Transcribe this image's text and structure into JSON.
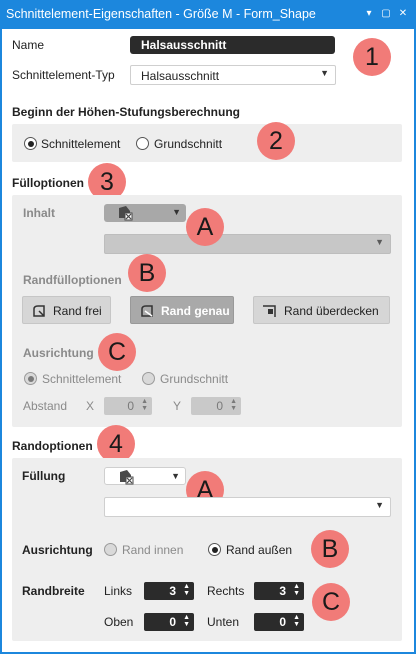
{
  "window": {
    "title": "Schnittelement-Eigenschaften - Größe M - Form_Shape",
    "buttons": {
      "dropdown_icon": "▾",
      "maximize_icon": "▢",
      "close_icon": "✕"
    }
  },
  "header": {
    "name_label": "Name",
    "name_value": "Halsausschnitt",
    "type_label": "Schnittelement-Typ",
    "type_value": "Halsausschnitt"
  },
  "beginn": {
    "title": "Beginn der Höhen-Stufungsberechnung",
    "options": [
      "Schnittelement",
      "Grundschnitt"
    ],
    "selected": "Schnittelement"
  },
  "fuelloptionen": {
    "title": "Fülloptionen",
    "inhalt_label": "Inhalt",
    "inhalt_select_value": "",
    "randfuell_title": "Randfülloptionen",
    "buttons": [
      "Rand frei",
      "Rand genau",
      "Rand überdecken"
    ],
    "selected_button": "Rand genau",
    "ausrichtung_label": "Ausrichtung",
    "ausrichtung_options": [
      "Schnittelement",
      "Grundschnitt"
    ],
    "ausrichtung_selected": "Schnittelement",
    "abstand_label": "Abstand",
    "x_label": "X",
    "x_value": "0",
    "y_label": "Y",
    "y_value": "0"
  },
  "randoptionen": {
    "title": "Randoptionen",
    "fuellung_label": "Füllung",
    "fuellung_select_value": "",
    "ausrichtung_label": "Ausrichtung",
    "ausrichtung_options": [
      "Rand innen",
      "Rand außen"
    ],
    "ausrichtung_selected": "Rand außen",
    "randbreite_label": "Randbreite",
    "links_label": "Links",
    "links_value": "3",
    "rechts_label": "Rechts",
    "rechts_value": "3",
    "oben_label": "Oben",
    "oben_value": "0",
    "unten_label": "Unten",
    "unten_value": "0"
  },
  "markers": [
    "1",
    "2",
    "3",
    "A",
    "B",
    "C",
    "4",
    "A",
    "B",
    "C"
  ],
  "colors": {
    "titlebar": "#1c87dd",
    "marker": "#f17b78",
    "panel": "#eeeeee",
    "dark_field": "#2b2b2b"
  },
  "icons": {
    "dropdown_arrow": "▼",
    "spin_arrows": "▲▼",
    "fill_icon": "fill-pattern-icon",
    "rand_frei_icon": "rand-frei-icon",
    "rand_genau_icon": "rand-genau-icon",
    "rand_ueberdecken_icon": "rand-ueberdecken-icon"
  }
}
